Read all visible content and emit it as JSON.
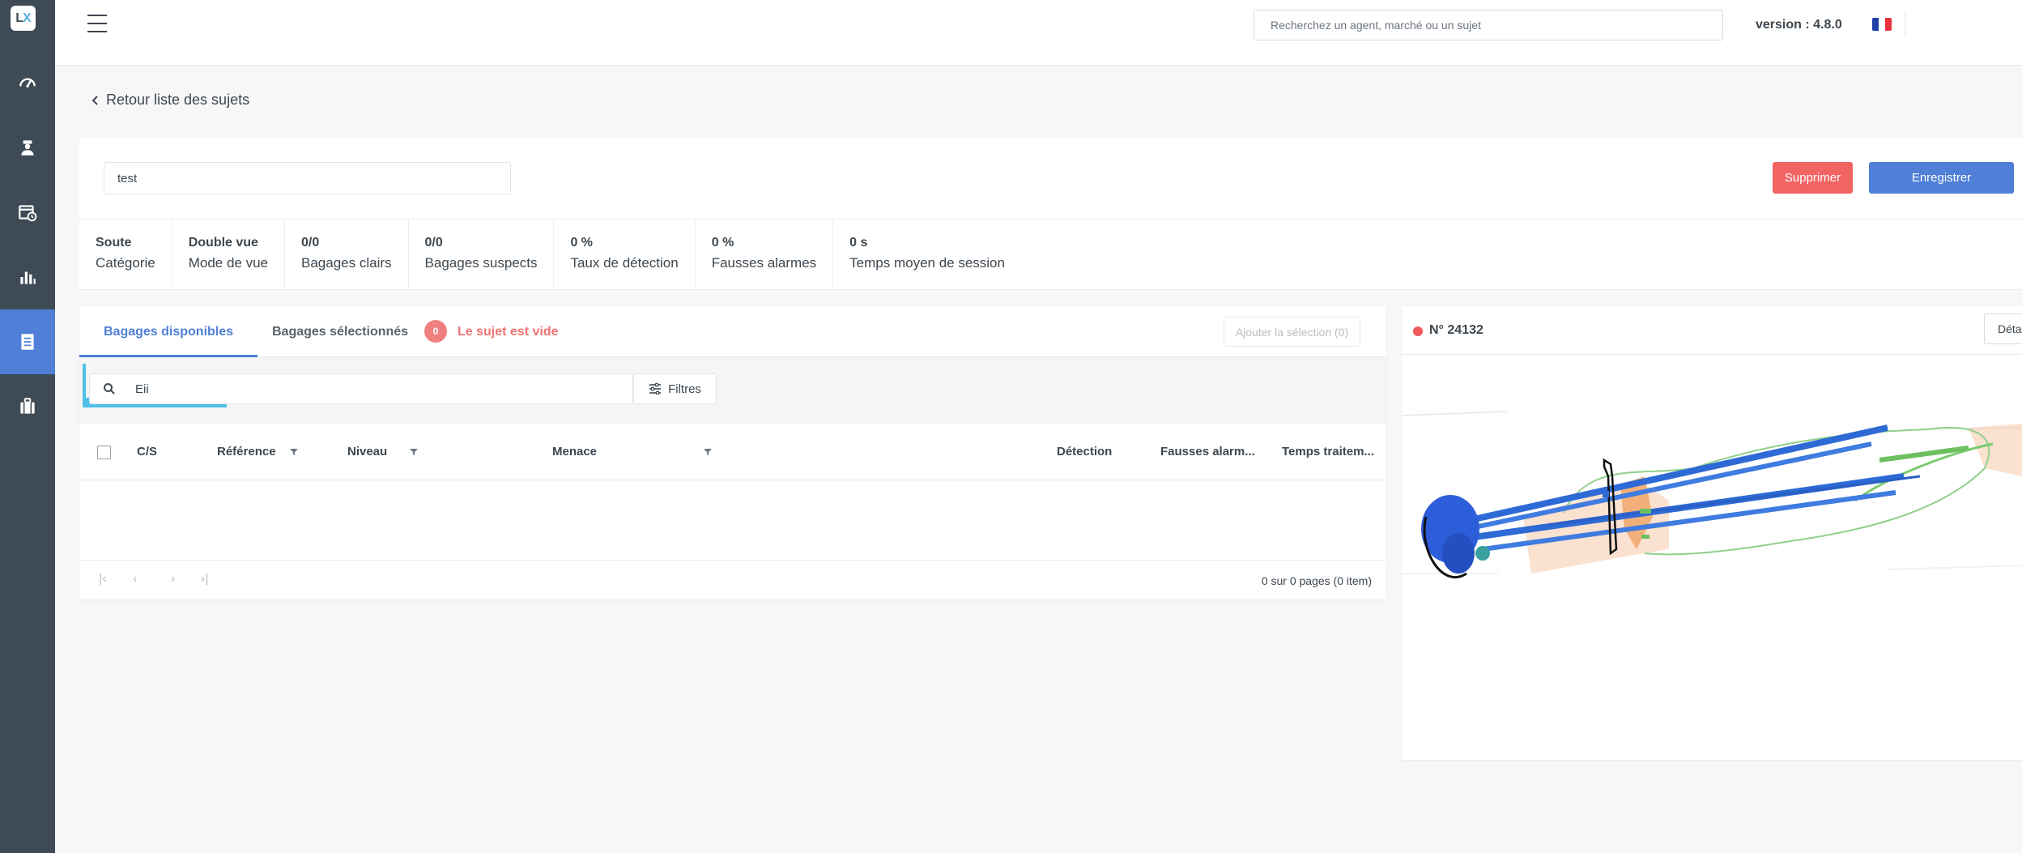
{
  "app": {
    "logo_text_a": "L",
    "logo_text_b": "X"
  },
  "sidebar": {
    "items": [
      {
        "name": "dashboard",
        "icon": "speedometer-icon",
        "active": false
      },
      {
        "name": "agents",
        "icon": "agent-icon",
        "active": false
      },
      {
        "name": "calendar",
        "icon": "calendar-icon",
        "active": false
      },
      {
        "name": "statistics",
        "icon": "bar-chart-icon",
        "active": false
      },
      {
        "name": "subjects",
        "icon": "document-icon",
        "active": true
      },
      {
        "name": "luggage",
        "icon": "suitcase-icon",
        "active": false
      }
    ]
  },
  "topbar": {
    "search_placeholder": "Recherchez un agent, marché ou un sujet",
    "version": "version : 4.8.0",
    "flag_colors": [
      "#1f3fa8",
      "#ffffff",
      "#e8323c"
    ]
  },
  "back_link": "Retour liste des sujets",
  "subject": {
    "name": "test",
    "delete_label": "Supprimer",
    "save_label": "Enregistrer"
  },
  "stats": [
    {
      "value": "Soute",
      "label": "Catégorie"
    },
    {
      "value": "Double vue",
      "label": "Mode de vue"
    },
    {
      "value": "0/0",
      "label": "Bagages clairs"
    },
    {
      "value": "0/0",
      "label": "Bagages suspects"
    },
    {
      "value": "0 %",
      "label": "Taux de détection"
    },
    {
      "value": "0 %",
      "label": "Fausses alarmes"
    },
    {
      "value": "0 s",
      "label": "Temps moyen de session"
    }
  ],
  "tabs": {
    "available": "Bagages disponibles",
    "selected": "Bagages sélectionnés",
    "count": "0",
    "empty_text": "Le sujet est vide",
    "add_label": "Ajouter la sélection (0)"
  },
  "filter": {
    "search_value": "Eii",
    "filters_label": "Filtres"
  },
  "table": {
    "columns": {
      "cs": "C/S",
      "reference": "Référence",
      "level": "Niveau",
      "threat": "Menace",
      "detection": "Détection",
      "false_alarms": "Fausses alarm...",
      "processing_time": "Temps traitem..."
    },
    "rows": []
  },
  "pagination": {
    "first": "|‹",
    "prev": "‹",
    "next": "›",
    "last": "›|",
    "info": "0 sur 0 pages (0 item)"
  },
  "preview": {
    "title": "N° 24132",
    "detail_label": "Déta",
    "status_color": "#f05a5a"
  }
}
